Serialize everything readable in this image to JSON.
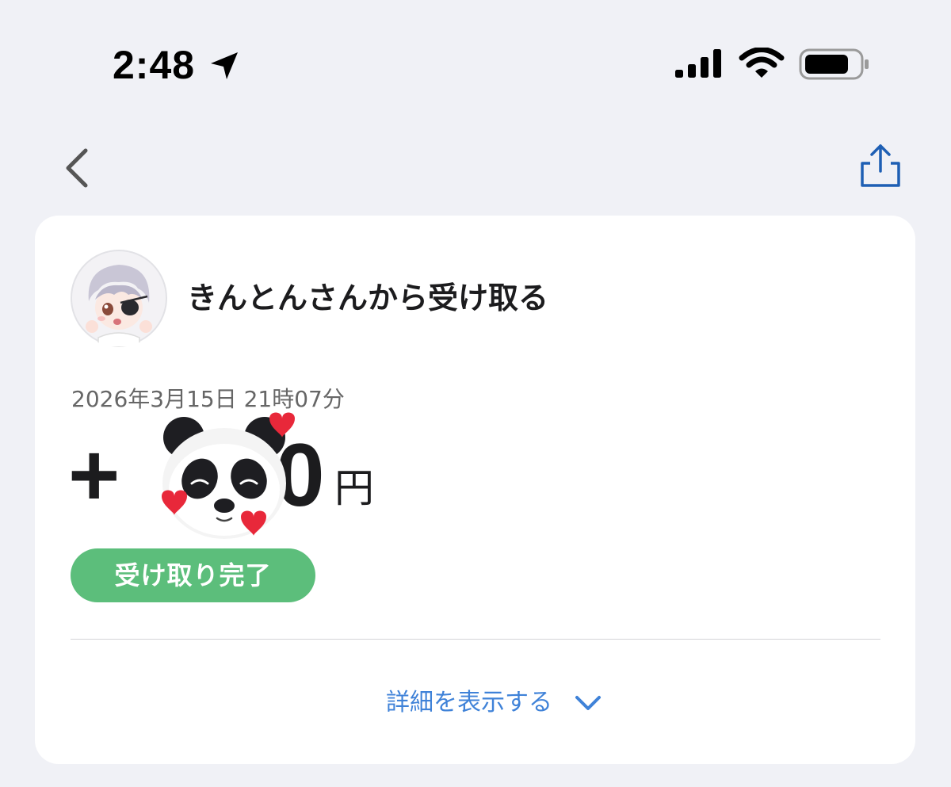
{
  "status_bar": {
    "time": "2:48"
  },
  "nav": {
    "back_icon": "chevron-left-icon",
    "share_icon": "share-icon"
  },
  "transaction": {
    "title": "きんとんさんから受け取る",
    "datetime": "2026年3月15日 21時07分",
    "amount_prefix": "+",
    "amount_visible_suffix": "0",
    "currency_unit": "円",
    "status": "受け取り完了",
    "details_label": "詳細を表示する"
  },
  "colors": {
    "background": "#f0f1f6",
    "card": "#ffffff",
    "status_badge": "#5cbe7b",
    "link": "#3f82d8",
    "share_icon": "#1e5fb4"
  }
}
